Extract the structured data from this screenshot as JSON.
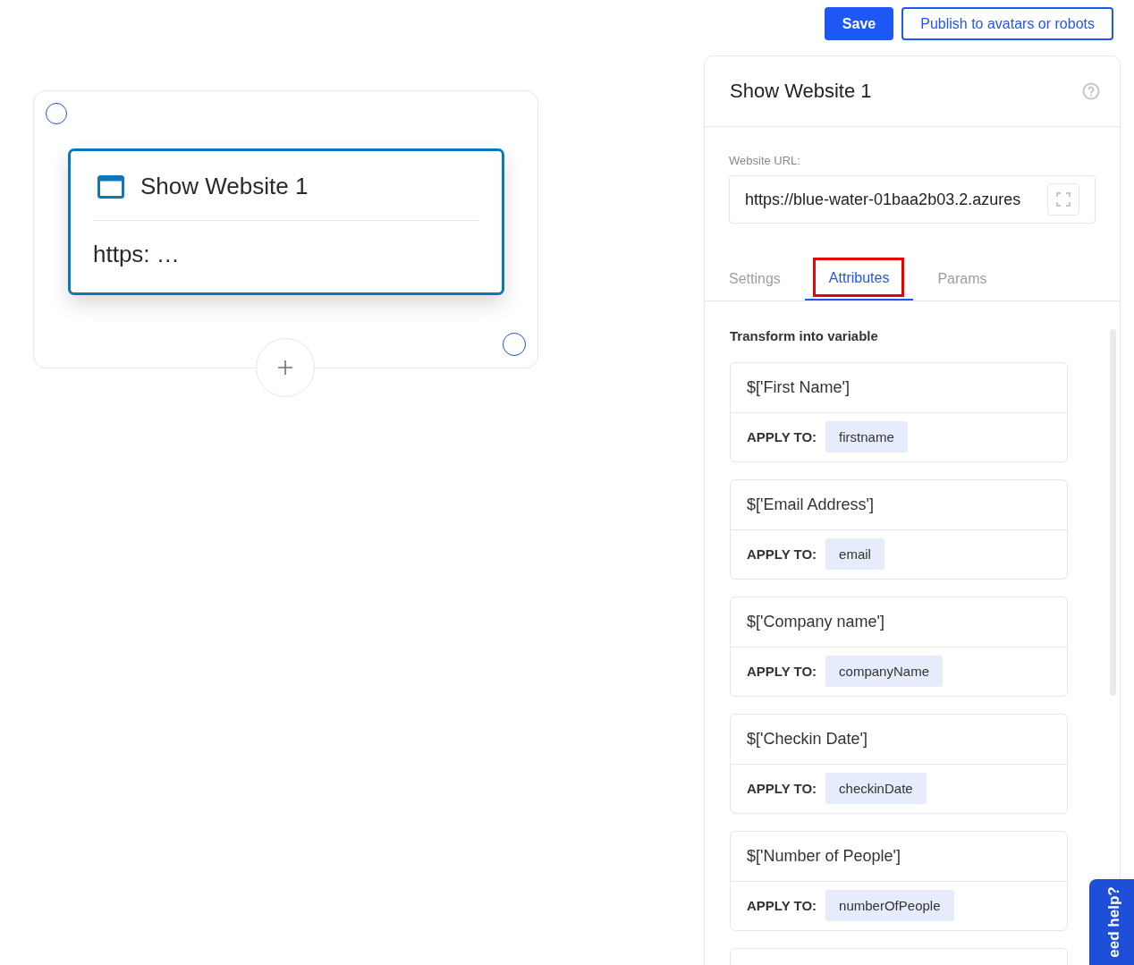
{
  "toolbar": {
    "buttons": [
      {
        "label": "Save",
        "kind": "primary"
      },
      {
        "label": "Publish to avatars or robots",
        "kind": "outline"
      }
    ]
  },
  "canvas": {
    "node": {
      "title": "Show Website 1",
      "subtitle": "https: …"
    }
  },
  "panel": {
    "title": "Show Website 1",
    "url_field": {
      "label": "Website URL:",
      "value": "https://blue-water-01baa2b03.2.azures"
    },
    "tabs": [
      {
        "label": "Settings",
        "selected": false,
        "highlighted": false
      },
      {
        "label": "Attributes",
        "selected": true,
        "highlighted": true
      },
      {
        "label": "Params",
        "selected": false,
        "highlighted": false
      }
    ],
    "section_title": "Transform into variable",
    "attributes": [
      {
        "name": "$['First Name']",
        "apply_label": "APPLY TO:",
        "variable": "firstname"
      },
      {
        "name": "$['Email Address']",
        "apply_label": "APPLY TO:",
        "variable": "email"
      },
      {
        "name": "$['Company name']",
        "apply_label": "APPLY TO:",
        "variable": "companyName"
      },
      {
        "name": "$['Checkin Date']",
        "apply_label": "APPLY TO:",
        "variable": "checkinDate"
      },
      {
        "name": "$['Number of People']",
        "apply_label": "APPLY TO:",
        "variable": "numberOfPeople"
      }
    ]
  },
  "help_tab": {
    "label": "eed help?"
  }
}
